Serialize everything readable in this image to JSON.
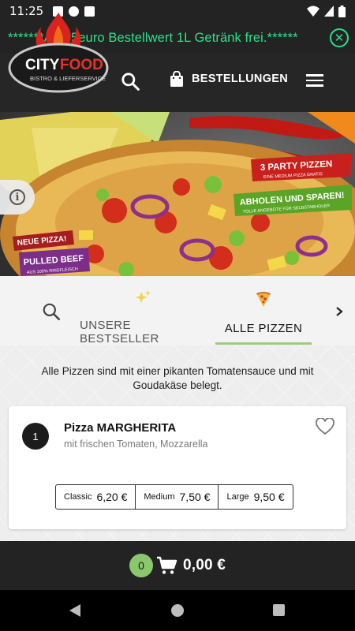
{
  "status_bar": {
    "time": "11:25"
  },
  "promo": {
    "text": "*******Ab 35euro Bestellwert 1L Getränk frei.******"
  },
  "header": {
    "logo_text_city": "CITY",
    "logo_text_food": "FOOD",
    "logo_subtitle": "BISTRO & LIEFERSERVICE",
    "orders_label": "BESTELLUNGEN"
  },
  "hero": {
    "badge_party_title": "3 PARTY PIZZEN",
    "badge_party_sub": "EINE MEDIUM PIZZA GRATIS",
    "badge_pickup_title": "ABHOLEN UND SPAREN!",
    "badge_pickup_sub": "TOLLE ANGEBOTE FÜR SELBSTABHOLER",
    "badge_new": "NEUE PIZZA!",
    "badge_beef_title": "PULLED BEEF",
    "badge_beef_sub": "AUS 100% RINDFLEISCH"
  },
  "tabs": [
    {
      "label": "UNSERE BESTSELLER",
      "icon": "sparkles-icon"
    },
    {
      "label": "ALLE PIZZEN",
      "icon": "pizza-icon"
    }
  ],
  "content": {
    "description": "Alle Pizzen sind mit einer pikanten Tomatensauce und mit Goudakäse belegt.",
    "items": [
      {
        "number": "1",
        "name": "Pizza MARGHERITA",
        "description": "mit frischen Tomaten, Mozzarella",
        "sizes": [
          {
            "label": "Classic",
            "price": "6,20 €"
          },
          {
            "label": "Medium",
            "price": "7,50 €"
          },
          {
            "label": "Large",
            "price": "9,50 €"
          }
        ]
      }
    ]
  },
  "cart": {
    "count": "0",
    "total": "0,00 €"
  },
  "colors": {
    "accent_green": "#2ee08a",
    "tab_underline": "#9ccc7a",
    "cart_badge": "#8bc76d",
    "dark_bg": "#232323"
  }
}
